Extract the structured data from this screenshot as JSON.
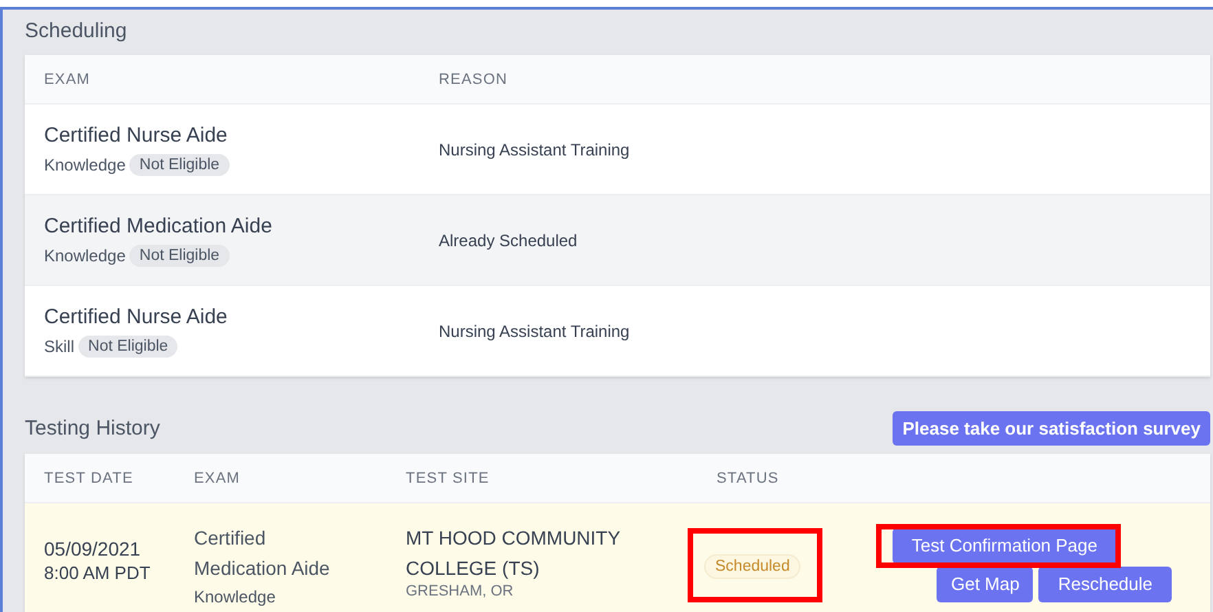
{
  "scheduling": {
    "title": "Scheduling",
    "columns": [
      "EXAM",
      "REASON"
    ],
    "rows": [
      {
        "exam": "Certified Nurse Aide",
        "type": "Knowledge",
        "badge": "Not Eligible",
        "reason": "Nursing Assistant Training",
        "shaded": false
      },
      {
        "exam": "Certified Medication Aide",
        "type": "Knowledge",
        "badge": "Not Eligible",
        "reason": "Already Scheduled",
        "shaded": true
      },
      {
        "exam": "Certified Nurse Aide",
        "type": "Skill",
        "badge": "Not Eligible",
        "reason": "Nursing Assistant Training",
        "shaded": false
      }
    ]
  },
  "testing_history": {
    "title": "Testing History",
    "survey_button": "Please take our satisfaction survey",
    "columns": [
      "TEST DATE",
      "EXAM",
      "TEST SITE",
      "STATUS"
    ],
    "rows": [
      {
        "date": "05/09/2021",
        "time": "8:00 AM PDT",
        "exam": "Certified Medication Aide",
        "type": "Knowledge",
        "site": "MT HOOD COMMUNITY COLLEGE (TS)",
        "location": "GRESHAM, OR",
        "status": "Scheduled",
        "status_highlighted": true,
        "actions": [
          {
            "label": "Test Confirmation Page",
            "kind": "block",
            "highlighted": true
          },
          {
            "label": "Get Map",
            "kind": "inline",
            "highlighted": false
          },
          {
            "label": "Reschedule",
            "kind": "block",
            "highlighted": false
          }
        ]
      }
    ]
  }
}
